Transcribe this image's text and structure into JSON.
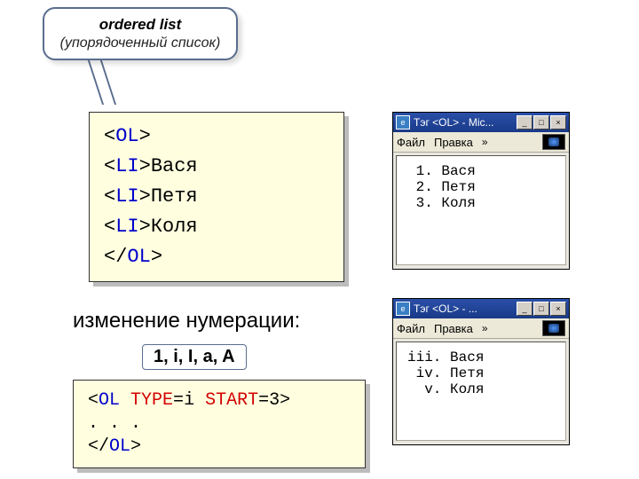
{
  "callout": {
    "title_bold": "ordered list",
    "title_sub": "(упорядоченный список)"
  },
  "code1": {
    "line1_open": "<OL>",
    "li_open": "<LI>",
    "item1": "Вася",
    "item2": "Петя",
    "item3": "Коля",
    "line5_close": "</OL>"
  },
  "section_label": "изменение нумерации:",
  "badge": "1, i, I, a, A",
  "code2": {
    "part1": "<OL ",
    "attr1": "TYPE",
    "eq1": "=",
    "val1": "i",
    "sp": " ",
    "attr2": "START",
    "eq2": "=",
    "val2": "3",
    "close1": ">",
    "line2": ". . .",
    "line3": "</OL>"
  },
  "win1": {
    "title": "Тэг <OL> - Mic...",
    "menu1": "Файл",
    "menu2": "Правка",
    "items": [
      " 1. Вася",
      " 2. Петя",
      " 3. Коля"
    ]
  },
  "win2": {
    "title": "Тэг <OL> - ...",
    "menu1": "Файл",
    "menu2": "Правка",
    "items": [
      "iii. Вася",
      " iv. Петя",
      "  v. Коля"
    ]
  },
  "min_glyph": "_",
  "max_glyph": "□",
  "close_glyph": "×",
  "chev_glyph": "»"
}
